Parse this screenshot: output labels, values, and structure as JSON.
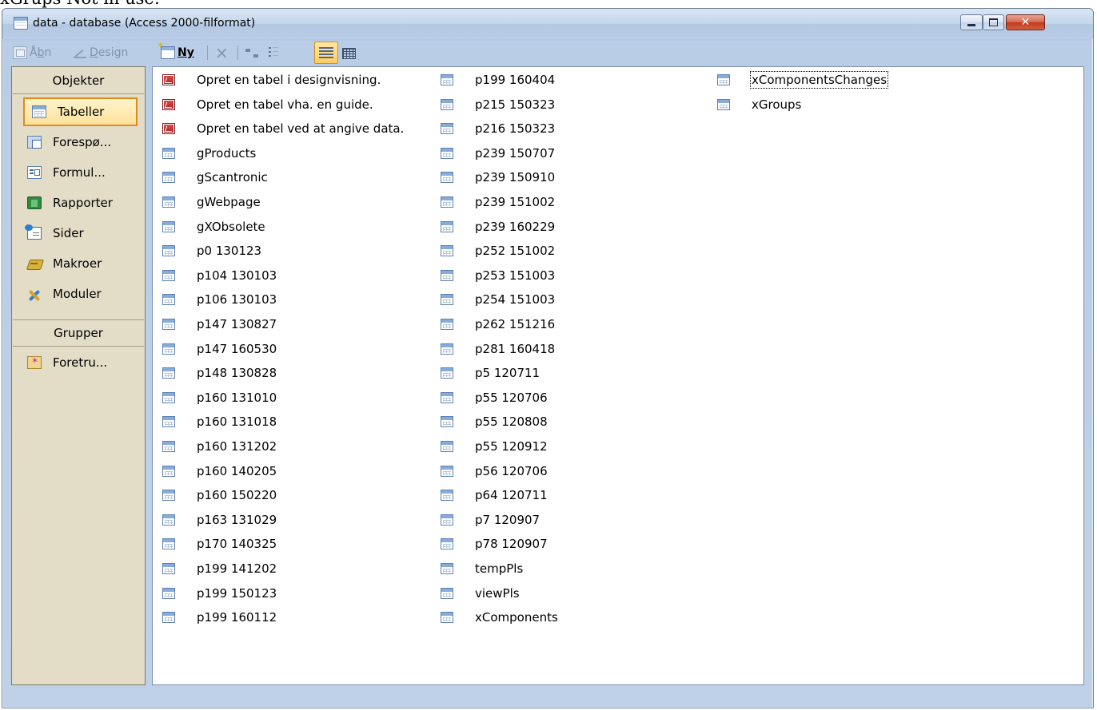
{
  "caption": "xGrups Not in use:",
  "window": {
    "title": "data - database (Access 2000-filformat)"
  },
  "toolbar": {
    "open_prefix": "Å",
    "open_accel": "b",
    "open_suffix": "n",
    "design_accel": "D",
    "design_rest": "esign",
    "new_accel": "N",
    "new_rest": "y",
    "delete_glyph": "×"
  },
  "sidebar": {
    "objects_header": "Objekter",
    "groups_header": "Grupper",
    "items": [
      {
        "label": "Tabeller",
        "icon": "table-icon"
      },
      {
        "label": "Forespø...",
        "icon": "query-icon"
      },
      {
        "label": "Formul...",
        "icon": "form-icon"
      },
      {
        "label": "Rapporter",
        "icon": "report-icon"
      },
      {
        "label": "Sider",
        "icon": "page-icon"
      },
      {
        "label": "Makroer",
        "icon": "macro-icon"
      },
      {
        "label": "Moduler",
        "icon": "module-icon"
      }
    ],
    "group_items": [
      {
        "label": "Foretru...",
        "icon": "favorites-folder-icon"
      }
    ]
  },
  "list": {
    "columns": [
      [
        "Opret en tabel i designvisning.",
        "Opret en tabel vha. en guide.",
        "Opret en tabel ved at angive data.",
        "gProducts",
        "gScantronic",
        "gWebpage",
        "gXObsolete",
        "p0 130123",
        "p104 130103",
        "p106 130103",
        "p147 130827",
        "p147 160530",
        "p148 130828",
        "p160 131010",
        "p160 131018",
        "p160 131202",
        "p160 140205",
        "p160 150220",
        "p163 131029",
        "p170 140325",
        "p199 141202",
        "p199 150123",
        "p199 160112"
      ],
      [
        "p199 160404",
        "p215 150323",
        "p216 150323",
        "p239 150707",
        "p239 150910",
        "p239 151002",
        "p239 160229",
        "p252 151002",
        "p253 151003",
        "p254 151003",
        "p262 151216",
        "p281 160418",
        "p5 120711",
        "p55 120706",
        "p55 120808",
        "p55 120912",
        "p56 120706",
        "p64 120711",
        "p7 120907",
        "p78 120907",
        "tempPls",
        "viewPls",
        "xComponents"
      ],
      [
        "xComponentsChanges",
        "xGroups"
      ]
    ]
  }
}
